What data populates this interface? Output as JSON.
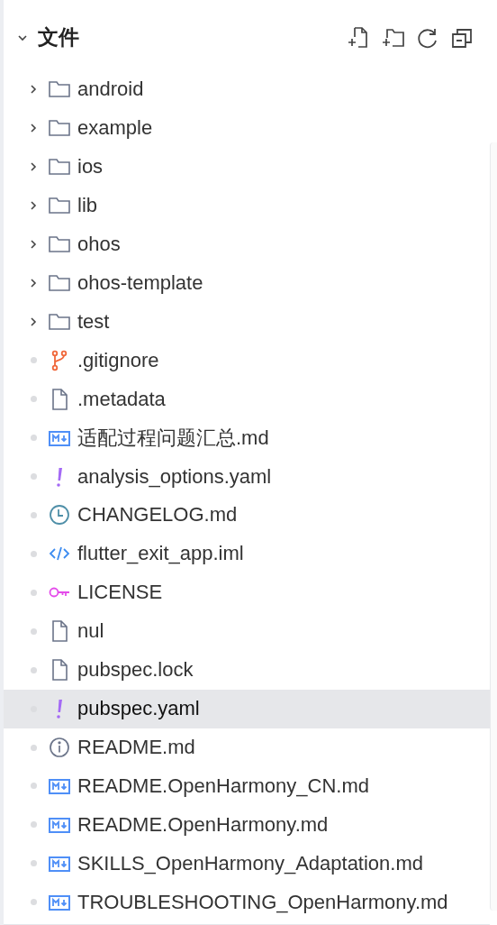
{
  "header": {
    "title": "文件",
    "expanded": true
  },
  "items": [
    {
      "kind": "folder",
      "name": "android",
      "expanded": false,
      "selected": false
    },
    {
      "kind": "folder",
      "name": "example",
      "expanded": false,
      "selected": false
    },
    {
      "kind": "folder",
      "name": "ios",
      "expanded": false,
      "selected": false
    },
    {
      "kind": "folder",
      "name": "lib",
      "expanded": false,
      "selected": false
    },
    {
      "kind": "folder",
      "name": "ohos",
      "expanded": false,
      "selected": false
    },
    {
      "kind": "folder",
      "name": "ohos-template",
      "expanded": false,
      "selected": false
    },
    {
      "kind": "folder",
      "name": "test",
      "expanded": false,
      "selected": false
    },
    {
      "kind": "git",
      "name": ".gitignore",
      "selected": false
    },
    {
      "kind": "file",
      "name": ".metadata",
      "selected": false
    },
    {
      "kind": "markdown",
      "name": "适配过程问题汇总.md",
      "selected": false
    },
    {
      "kind": "yaml",
      "name": "analysis_options.yaml",
      "selected": false
    },
    {
      "kind": "changelog",
      "name": "CHANGELOG.md",
      "selected": false
    },
    {
      "kind": "code",
      "name": "flutter_exit_app.iml",
      "selected": false
    },
    {
      "kind": "license",
      "name": "LICENSE",
      "selected": false
    },
    {
      "kind": "file",
      "name": "nul",
      "selected": false
    },
    {
      "kind": "file",
      "name": "pubspec.lock",
      "selected": false
    },
    {
      "kind": "yaml",
      "name": "pubspec.yaml",
      "selected": true
    },
    {
      "kind": "info",
      "name": "README.md",
      "selected": false
    },
    {
      "kind": "markdown",
      "name": "README.OpenHarmony_CN.md",
      "selected": false
    },
    {
      "kind": "markdown",
      "name": "README.OpenHarmony.md",
      "selected": false
    },
    {
      "kind": "markdown",
      "name": "SKILLS_OpenHarmony_Adaptation.md",
      "selected": false
    },
    {
      "kind": "markdown",
      "name": "TROUBLESHOOTING_OpenHarmony.md",
      "selected": false
    }
  ]
}
